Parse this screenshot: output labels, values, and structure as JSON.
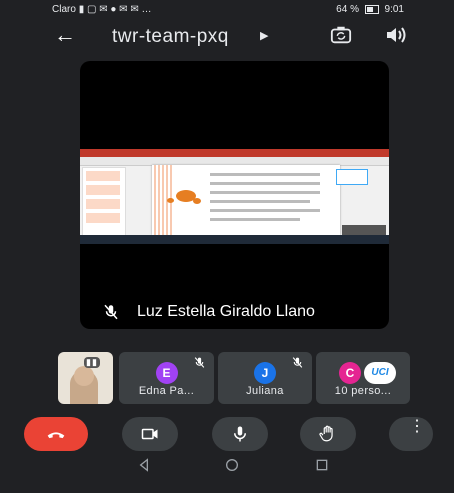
{
  "status_bar": {
    "carrier": "Claro",
    "battery": "64 %",
    "time": "9:01"
  },
  "app_bar": {
    "meeting_code": "twr-team-pxq"
  },
  "main_stage": {
    "presenter_name": "Luz Estella Giraldo Llano"
  },
  "participants": [
    {
      "initial": "E",
      "name": "Edna Pa...",
      "color": "#a142f4",
      "muted": true
    },
    {
      "initial": "J",
      "name": "Juliana",
      "color": "#1a73e8",
      "muted": true
    },
    {
      "initial": "C",
      "name": "10 perso...",
      "color": "#e52592",
      "badge": "UCI"
    }
  ],
  "controls": {
    "end_call_color": "#ea4335"
  }
}
